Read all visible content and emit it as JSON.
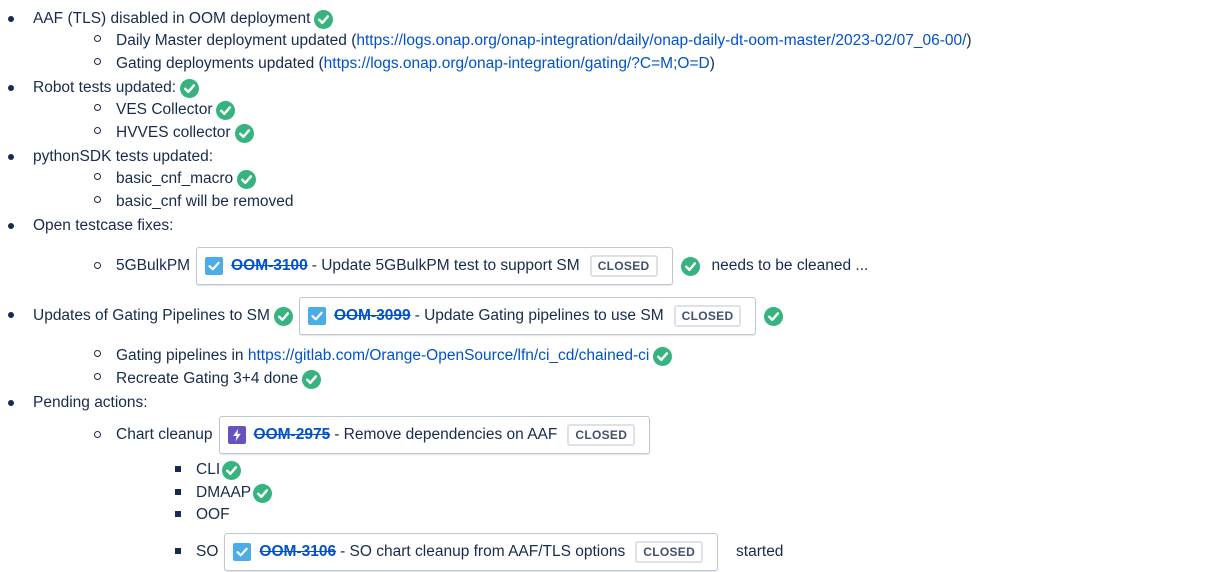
{
  "items": {
    "aaf_disabled": "AAF (TLS) disabled in OOM deployment",
    "daily_pre": "Daily Master deployment updated (",
    "daily_link": "https://logs.onap.org/onap-integration/daily/onap-daily-dt-oom-master/2023-02/07_06-00/",
    "daily_post": ")",
    "gating_pre": "Gating deployments updated (",
    "gating_link": "https://logs.onap.org/onap-integration/gating/?C=M;O=D",
    "gating_post": ")",
    "robot": "Robot tests updated:",
    "ves": "VES Collector",
    "hvves": "HVVES collector",
    "pythonsdk": "pythonSDK tests updated:",
    "basic_cnf_macro": "basic_cnf_macro",
    "basic_cnf_removed": "basic_cnf will be removed",
    "open_fixes": "Open testcase fixes:",
    "bulkpm": "5GBulkPM",
    "needs_cleaned": "needs to be cleaned ...",
    "gating_pipelines_sm": "Updates of Gating Pipelines to SM",
    "gating_pipelines_in": "Gating pipelines in ",
    "gitlab_link": "https://gitlab.com/Orange-OpenSource/lfn/ci_cd/chained-ci",
    "recreate": "Recreate Gating 3+4 done",
    "pending": "Pending actions:",
    "chart_cleanup": "Chart cleanup",
    "cli": "CLI",
    "dmaap": "DMAAP",
    "oof": "OOF",
    "so": "SO",
    "started": "started"
  },
  "jira": {
    "oom3100": {
      "key": "OOM-3100",
      "summary": "- Update 5GBulkPM test to support SM",
      "status": "CLOSED",
      "type_icon": "task-check-icon"
    },
    "oom3099": {
      "key": "OOM-3099",
      "summary": "- Update Gating pipelines to use SM",
      "status": "CLOSED",
      "type_icon": "task-check-icon"
    },
    "oom2975": {
      "key": "OOM-2975",
      "summary": "- Remove dependencies on AAF",
      "status": "CLOSED",
      "type_icon": "epic-lightning-icon"
    },
    "oom3106": {
      "key": "OOM-3106",
      "summary": "- SO chart cleanup from AAF/TLS options",
      "status": "CLOSED",
      "type_icon": "task-check-icon"
    }
  },
  "colors": {
    "check_green": "#36b37e",
    "link": "#0052cc",
    "epic_purple": "#6554c0",
    "task_blue": "#4bade8"
  }
}
